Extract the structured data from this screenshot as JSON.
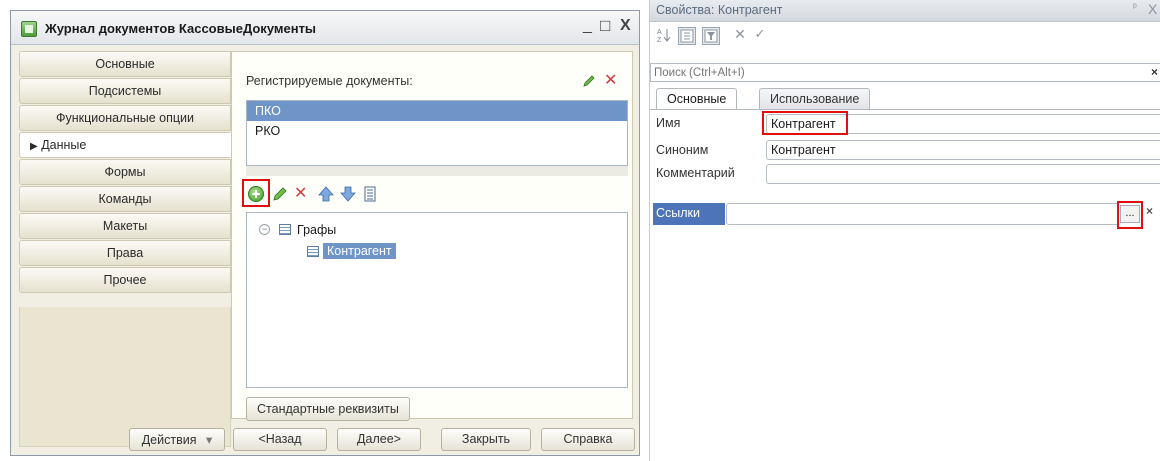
{
  "window": {
    "title": "Журнал документов КассовыеДокументы",
    "controls": [
      "_",
      "□",
      "X"
    ]
  },
  "tabs": [
    {
      "label": "Основные"
    },
    {
      "label": "Подсистемы"
    },
    {
      "label": "Функциональные опции"
    },
    {
      "label": "Данные",
      "marker": "▶"
    },
    {
      "label": "Формы"
    },
    {
      "label": "Команды"
    },
    {
      "label": "Макеты"
    },
    {
      "label": "Права"
    },
    {
      "label": "Прочее"
    }
  ],
  "main": {
    "registered_label": "Регистрируемые документы:",
    "documents": [
      "ПКО",
      "РКО"
    ],
    "tree": {
      "root": "Графы",
      "child": "Контрагент"
    },
    "std_button": "Стандартные реквизиты"
  },
  "bottom": {
    "actions": "Действия",
    "actions_arrow": "▾",
    "back": "<Назад",
    "next": "Далее>",
    "close": "Закрыть",
    "help": "Справка"
  },
  "props": {
    "title": "Свойства: Контрагент",
    "title_icons": [
      "ᵖ",
      "X"
    ],
    "toolbar": [
      "sort-az-icon",
      "tree-icon",
      "filter-icon",
      "delete-icon",
      "check-icon"
    ],
    "search_placeholder": "Поиск (Ctrl+Alt+I)",
    "search_clear": "×",
    "tabs": [
      "Основные",
      "Использование"
    ],
    "fields": {
      "name_label": "Имя",
      "name_value": "Контрагент",
      "synonym_label": "Синоним",
      "synonym_value": "Контрагент",
      "comment_label": "Комментарий",
      "comment_value": ""
    },
    "links_label": "Ссылки",
    "dots": "...",
    "links_clear": "×"
  },
  "colors": {
    "selection": "#6f95c8",
    "links_label_bg": "#4d74b8",
    "highlight_frame": "#e01010"
  }
}
